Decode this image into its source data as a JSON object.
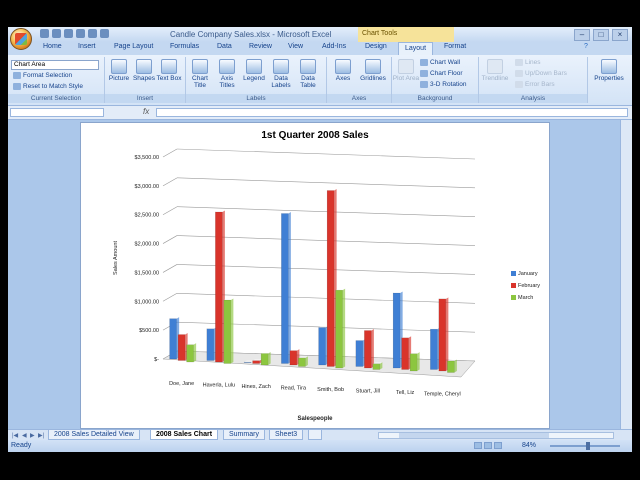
{
  "window": {
    "title": "Candle Company Sales.xlsx - Microsoft Excel",
    "context_tab_group": "Chart Tools"
  },
  "ribbon_tabs": [
    {
      "label": "Home"
    },
    {
      "label": "Insert"
    },
    {
      "label": "Page Layout"
    },
    {
      "label": "Formulas"
    },
    {
      "label": "Data"
    },
    {
      "label": "Review"
    },
    {
      "label": "View"
    },
    {
      "label": "Add-Ins"
    },
    {
      "label": "Design"
    },
    {
      "label": "Layout",
      "active": true
    },
    {
      "label": "Format"
    }
  ],
  "ribbon": {
    "current_selection": {
      "group_label": "Current Selection",
      "dropdown_value": "Chart Area",
      "format_selection": "Format Selection",
      "reset_style": "Reset to Match Style"
    },
    "insert": {
      "group_label": "Insert",
      "picture": "Picture",
      "shapes": "Shapes",
      "text_box": "Text Box"
    },
    "labels": {
      "group_label": "Labels",
      "chart_title": "Chart Title",
      "axis_titles": "Axis Titles",
      "legend": "Legend",
      "data_labels": "Data Labels",
      "data_table": "Data Table"
    },
    "axes": {
      "group_label": "Axes",
      "axes": "Axes",
      "gridlines": "Gridlines"
    },
    "background": {
      "group_label": "Background",
      "plot_area": "Plot Area",
      "chart_wall": "Chart Wall",
      "chart_floor": "Chart Floor",
      "rotation": "3-D Rotation"
    },
    "analysis": {
      "group_label": "Analysis",
      "trendline": "Trendline",
      "lines": "Lines",
      "up_down_bars": "Up/Down Bars",
      "error_bars": "Error Bars"
    },
    "properties": {
      "label": "Properties"
    }
  },
  "sheet_tabs": [
    {
      "label": "2008 Sales Detailed View"
    },
    {
      "label": "2008 Sales Chart",
      "active": true
    },
    {
      "label": "Summary"
    },
    {
      "label": "Sheet3"
    }
  ],
  "status": {
    "ready": "Ready",
    "zoom": "84%"
  },
  "chart_data": {
    "type": "bar",
    "title": "1st Quarter 2008 Sales",
    "xlabel": "Salespeople",
    "ylabel": "Sales Amount",
    "categories": [
      "Doe, Jane",
      "Haverla, Lulu",
      "Hines, Zach",
      "Read, Tira",
      "Smith, Bob",
      "Stuart, Jill",
      "Tell, Liz",
      "Temple, Cheryl"
    ],
    "series": [
      {
        "name": "January",
        "color": "#3f7fd4",
        "values": [
          700,
          550,
          0,
          2600,
          650,
          450,
          1300,
          700
        ]
      },
      {
        "name": "February",
        "color": "#d9342b",
        "values": [
          450,
          2600,
          50,
          250,
          3050,
          650,
          550,
          1250
        ]
      },
      {
        "name": "March",
        "color": "#8cc63f",
        "values": [
          300,
          1100,
          200,
          150,
          1350,
          100,
          300,
          200
        ]
      }
    ],
    "yticks": [
      "$3,500.00",
      "$3,000.00",
      "$2,500.00",
      "$2,000.00",
      "$1,500.00",
      "$1,000.00",
      "$500.00",
      "$-"
    ],
    "ylim": [
      0,
      3500
    ],
    "legend_position": "right",
    "grid": true,
    "style": "3-D clustered column"
  }
}
